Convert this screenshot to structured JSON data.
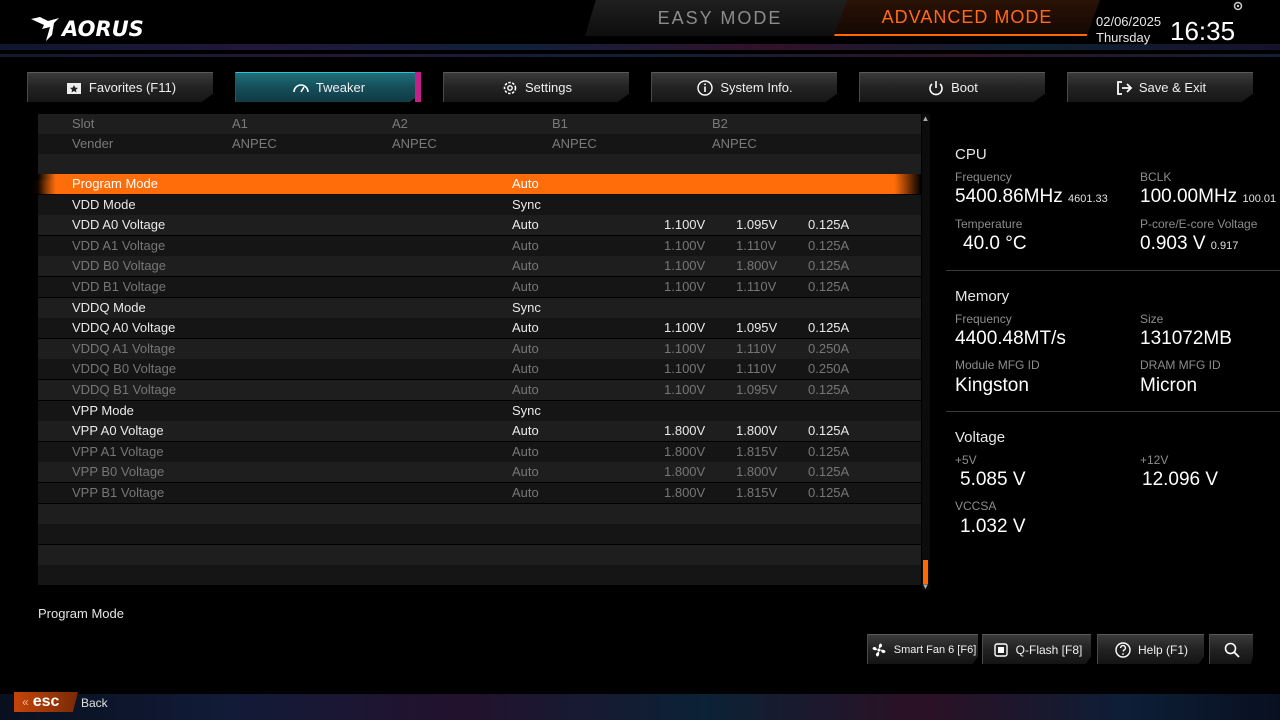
{
  "brand": "AORUS",
  "modes": {
    "easy": "EASY MODE",
    "advanced": "ADVANCED MODE"
  },
  "datetime": {
    "date": "02/06/2025",
    "day": "Thursday",
    "time": "16:35"
  },
  "tabs": [
    {
      "label": "Favorites (F11)",
      "icon": "star-folder-icon",
      "active": false
    },
    {
      "label": "Tweaker",
      "icon": "speedometer-icon",
      "active": true
    },
    {
      "label": "Settings",
      "icon": "gear-icon",
      "active": false
    },
    {
      "label": "System Info.",
      "icon": "info-icon",
      "active": false
    },
    {
      "label": "Boot",
      "icon": "power-icon",
      "active": false
    },
    {
      "label": "Save & Exit",
      "icon": "exit-icon",
      "active": false
    }
  ],
  "table": {
    "header": [
      {
        "label": "Slot",
        "a1": "A1",
        "a2": "A2",
        "b1": "B1",
        "b2": "B2"
      },
      {
        "label": "Vender",
        "a1": "ANPEC",
        "a2": "ANPEC",
        "b1": "ANPEC",
        "b2": "ANPEC"
      }
    ],
    "rows": [
      {
        "name": "Program Mode",
        "setting": "Auto",
        "v1": "",
        "v2": "",
        "amp": "",
        "state": "selected"
      },
      {
        "name": "VDD Mode",
        "setting": "Sync",
        "v1": "",
        "v2": "",
        "amp": "",
        "state": "enabled"
      },
      {
        "name": "VDD A0 Voltage",
        "setting": "Auto",
        "v1": "1.100V",
        "v2": "1.095V",
        "amp": "0.125A",
        "state": "enabled"
      },
      {
        "name": "VDD A1 Voltage",
        "setting": "Auto",
        "v1": "1.100V",
        "v2": "1.110V",
        "amp": "0.125A",
        "state": "disabled"
      },
      {
        "name": "VDD B0 Voltage",
        "setting": "Auto",
        "v1": "1.100V",
        "v2": "1.800V",
        "amp": "0.125A",
        "state": "disabled"
      },
      {
        "name": "VDD B1 Voltage",
        "setting": "Auto",
        "v1": "1.100V",
        "v2": "1.110V",
        "amp": "0.125A",
        "state": "disabled"
      },
      {
        "name": "VDDQ Mode",
        "setting": "Sync",
        "v1": "",
        "v2": "",
        "amp": "",
        "state": "enabled"
      },
      {
        "name": "VDDQ A0 Voltage",
        "setting": "Auto",
        "v1": "1.100V",
        "v2": "1.095V",
        "amp": "0.125A",
        "state": "enabled"
      },
      {
        "name": "VDDQ A1 Voltage",
        "setting": "Auto",
        "v1": "1.100V",
        "v2": "1.110V",
        "amp": "0.250A",
        "state": "disabled"
      },
      {
        "name": "VDDQ B0 Voltage",
        "setting": "Auto",
        "v1": "1.100V",
        "v2": "1.110V",
        "amp": "0.250A",
        "state": "disabled"
      },
      {
        "name": "VDDQ B1 Voltage",
        "setting": "Auto",
        "v1": "1.100V",
        "v2": "1.095V",
        "amp": "0.125A",
        "state": "disabled"
      },
      {
        "name": "VPP Mode",
        "setting": "Sync",
        "v1": "",
        "v2": "",
        "amp": "",
        "state": "enabled"
      },
      {
        "name": "VPP A0 Voltage",
        "setting": "Auto",
        "v1": "1.800V",
        "v2": "1.800V",
        "amp": "0.125A",
        "state": "enabled"
      },
      {
        "name": "VPP A1 Voltage",
        "setting": "Auto",
        "v1": "1.800V",
        "v2": "1.815V",
        "amp": "0.125A",
        "state": "disabled"
      },
      {
        "name": "VPP B0 Voltage",
        "setting": "Auto",
        "v1": "1.800V",
        "v2": "1.800V",
        "amp": "0.125A",
        "state": "disabled"
      },
      {
        "name": "VPP B1 Voltage",
        "setting": "Auto",
        "v1": "1.800V",
        "v2": "1.815V",
        "amp": "0.125A",
        "state": "disabled"
      }
    ],
    "empty_rows_after": 4
  },
  "help_text": "Program Mode",
  "info": {
    "cpu": {
      "title": "CPU",
      "frequency_label": "Frequency",
      "frequency": "5400.86MHz",
      "frequency_sub": "4601.33",
      "bclk_label": "BCLK",
      "bclk": "100.00MHz",
      "bclk_sub": "100.01",
      "temp_label": "Temperature",
      "temp": "40.0 °C",
      "volt_label": "P-core/E-core Voltage",
      "volt": "0.903 V",
      "volt_sub": "0.917"
    },
    "memory": {
      "title": "Memory",
      "frequency_label": "Frequency",
      "frequency": "4400.48MT/s",
      "size_label": "Size",
      "size": "131072MB",
      "module_label": "Module MFG ID",
      "module": "Kingston",
      "dram_label": "DRAM MFG ID",
      "dram": "Micron"
    },
    "voltage": {
      "title": "Voltage",
      "v5_label": "+5V",
      "v5": "5.085 V",
      "v12_label": "+12V",
      "v12": "12.096 V",
      "vccsa_label": "VCCSA",
      "vccsa": "1.032 V"
    }
  },
  "bottom_buttons": [
    {
      "label": "Smart Fan 6 [F6]",
      "icon": "fan-icon"
    },
    {
      "label": "Q-Flash [F8]",
      "icon": "chip-icon"
    },
    {
      "label": "Help (F1)",
      "icon": "help-icon"
    },
    {
      "label": "",
      "icon": "search-icon"
    }
  ],
  "esc": {
    "key": "esc",
    "label": "Back"
  },
  "colors": {
    "accent": "#ff6a00",
    "active_tab": "#1f6f7a",
    "tab_accent": "#c2208a"
  }
}
